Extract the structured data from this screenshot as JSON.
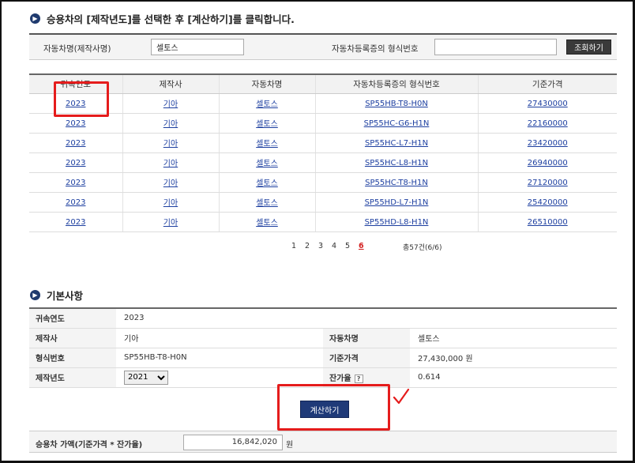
{
  "instruction": "승용차의 [제작년도]를 선택한 후 [계산하기]를 클릭합니다.",
  "search": {
    "name_label": "자동차명(제작사명)",
    "name_value": "셀토스",
    "model_label": "자동차등록증의 형식번호",
    "model_value": "",
    "button": "조회하기"
  },
  "table": {
    "headers": [
      "귀속연도",
      "제작사",
      "자동차명",
      "자동차등록증의 형식번호",
      "기준가격"
    ],
    "rows": [
      [
        "2023",
        "기아",
        "셀토스",
        "SP55HB-T8-H0N",
        "27430000"
      ],
      [
        "2023",
        "기아",
        "셀토스",
        "SP55HC-G6-H1N",
        "22160000"
      ],
      [
        "2023",
        "기아",
        "셀토스",
        "SP55HC-L7-H1N",
        "23420000"
      ],
      [
        "2023",
        "기아",
        "셀토스",
        "SP55HC-L8-H1N",
        "26940000"
      ],
      [
        "2023",
        "기아",
        "셀토스",
        "SP55HC-T8-H1N",
        "27120000"
      ],
      [
        "2023",
        "기아",
        "셀토스",
        "SP55HD-L7-H1N",
        "25420000"
      ],
      [
        "2023",
        "기아",
        "셀토스",
        "SP55HD-L8-H1N",
        "26510000"
      ]
    ]
  },
  "pager": {
    "pages": [
      "1",
      "2",
      "3",
      "4",
      "5",
      "6"
    ],
    "current": "6",
    "total": "총57건(6/6)"
  },
  "basic": {
    "title": "기본사항",
    "year_label": "귀속연도",
    "year_value": "2023",
    "maker_label": "제작사",
    "maker_value": "기아",
    "car_label": "자동차명",
    "car_value": "셀토스",
    "model_label": "형식번호",
    "model_value": "SP55HB-T8-H0N",
    "price_label": "기준가격",
    "price_value": "27,430,000 원",
    "made_label": "제작년도",
    "made_value": "2021",
    "residual_label": "잔가율",
    "residual_value": "0.614",
    "help": "?"
  },
  "calc_button": "계산하기",
  "result": {
    "label": "승용차 가액(기준가격 * 잔가율)",
    "value": "16,842,020",
    "unit": "원"
  },
  "colors": {
    "accent": "#1f3a78",
    "link": "#1d3fa0",
    "highlight": "#e51c1c"
  },
  "icons": {
    "bullet": "circle-arrow-icon",
    "check": "red-check-mark-icon"
  }
}
